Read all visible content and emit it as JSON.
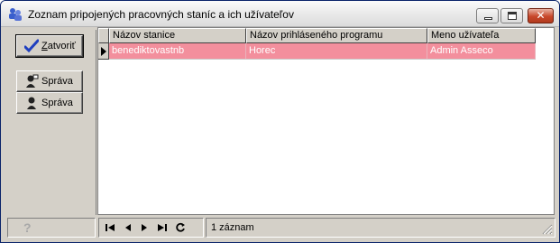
{
  "window": {
    "title": "Zoznam pripojených pracovných staníc a ich užívateľov",
    "icon": "workstation-users-icon",
    "controls": {
      "minimize": "minimize-icon",
      "maximize": "maximize-icon",
      "close": "✕"
    }
  },
  "sidebar": {
    "buttons": [
      {
        "label_underline": "Z",
        "label_rest": "atvoriť",
        "icon": "checkmark-icon",
        "default": true
      },
      {
        "label": "Správa",
        "icon": "user-message-icon"
      },
      {
        "label": "Správa",
        "icon": "user-icon"
      }
    ]
  },
  "grid": {
    "columns": [
      "Názov stanice",
      "Názov prihláseného programu",
      "Meno užívateľa"
    ],
    "rows": [
      {
        "station": "benediktovastnb",
        "program": "Horec",
        "user": "Admin Asseco",
        "selected": true
      }
    ],
    "highlight_color": "#f38f9d"
  },
  "statusbar": {
    "help": "?",
    "nav": [
      "first-record-icon",
      "prev-record-icon",
      "next-record-icon",
      "last-record-icon",
      "refresh-icon"
    ],
    "record_count": "1 záznam"
  }
}
